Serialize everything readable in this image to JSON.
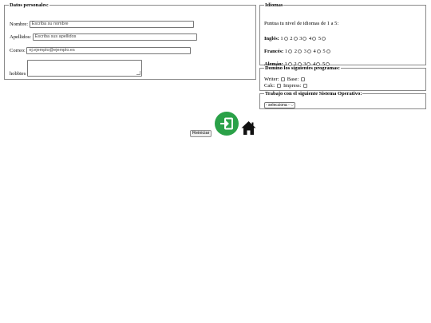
{
  "personal": {
    "legend": "Datos personales:",
    "nombre_label": "Nombre:",
    "nombre_placeholder": "Escriba su nombre",
    "apellidos_label": "Apellidos:",
    "apellidos_placeholder": "Escriba sus apellidos",
    "correo_label": "Correo:",
    "correo_placeholder": "ej.ejemplo@ejemplo.es",
    "hobbies_label": "hobbies"
  },
  "idiomas": {
    "legend": "Idiomas",
    "intro": "Puntua tu nivel de idiomas de 1 a 5:",
    "languages": [
      {
        "label": "Inglés:"
      },
      {
        "label": "Francés:"
      },
      {
        "label": "Alemán:"
      }
    ],
    "levels": [
      "1",
      "2",
      "3",
      "4",
      "5"
    ]
  },
  "programas": {
    "legend": "Domino los siguientes programas:",
    "items": [
      "Writer:",
      "Base:",
      "Calc:",
      "Impress:"
    ]
  },
  "sistema": {
    "legend": "Trabajo con el siguiente Sistema Operativo:",
    "selected": "- selecciona -"
  },
  "actions": {
    "reset_label": "Reiniciar",
    "submit_icon": "enter-icon",
    "home_icon": "home-icon",
    "submit_color": "#2aa148"
  }
}
